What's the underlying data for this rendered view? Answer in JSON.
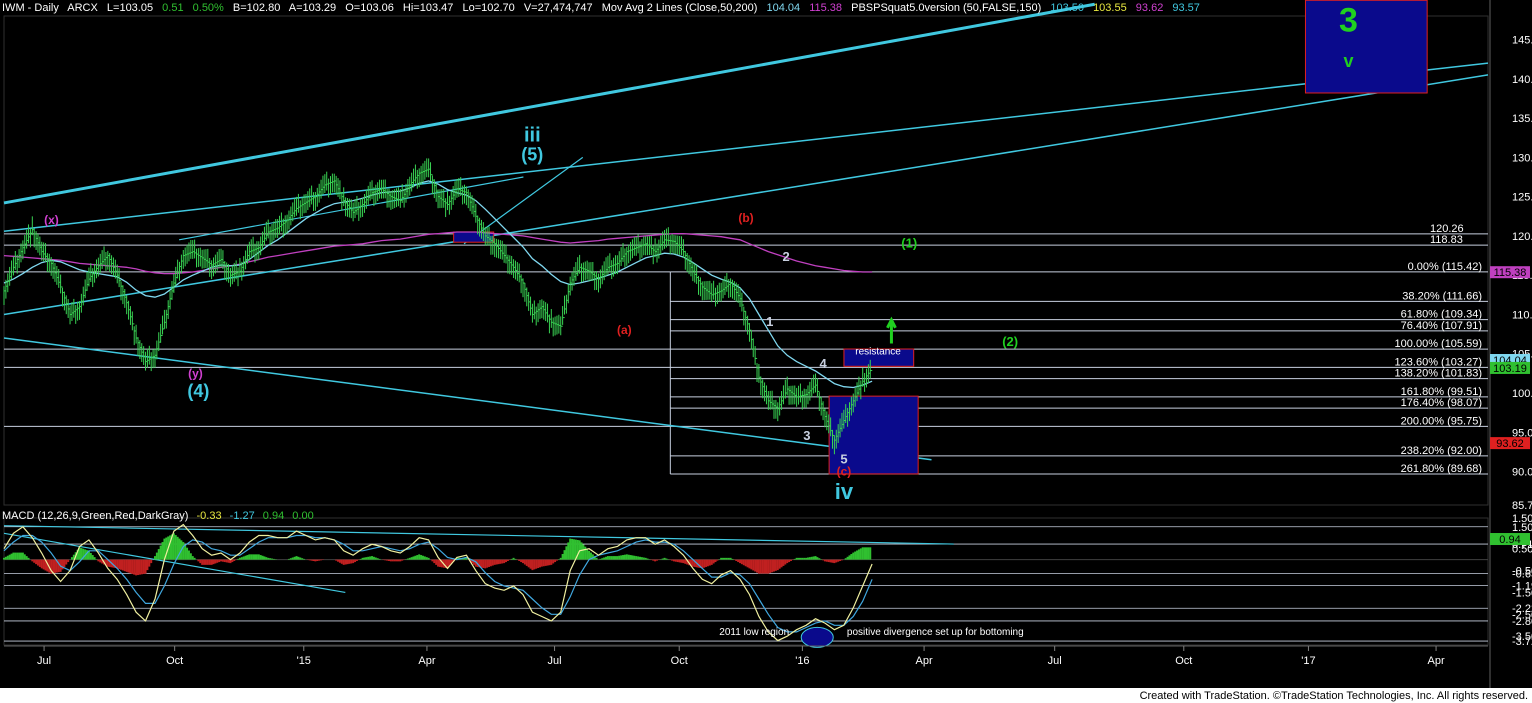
{
  "header": {
    "symbol": "IWM - Daily",
    "exchange": "ARCX",
    "last": "L=103.05",
    "change": "0.51",
    "pct": "0.50%",
    "bid": "B=102.80",
    "ask": "A=103.29",
    "open": "O=103.06",
    "high": "Hi=103.47",
    "low": "Lo=102.70",
    "volume": "V=27,474,747",
    "ma_label": "Mov Avg 2 Lines (Close,50,200)",
    "ma50": "104.04",
    "ma200": "115.38",
    "pbsp_label": "PBSPSquat5.0version (50,FALSE,150)",
    "pbsp_values": [
      "103.50",
      "103.55",
      "93.62",
      "93.57"
    ]
  },
  "macd_header": {
    "label": "MACD (12,26,9,Green,Red,DarkGray)",
    "values": [
      "-0.33",
      "-1.27",
      "0.94",
      "0.00"
    ]
  },
  "colors": {
    "background": "#000000",
    "price_bars": "#39d353",
    "trend_line": "#40c8e0",
    "ma200": "#c040c0",
    "ma50": "#80d8f0",
    "h_line": "#c8d0e0",
    "box_fill": "#0a0a8c",
    "box_border": "#e02020",
    "wave_cyan": "#40c8e0",
    "wave_red": "#e02020",
    "wave_green": "#20d020",
    "wave_magenta": "#d040d0",
    "macd_hist_pos": "#30c030",
    "macd_hist_neg": "#c02020",
    "macd_line": "#f0f0a0",
    "signal_line": "#40a8e0"
  },
  "chart_data": {
    "type": "ohlc",
    "price_axis": {
      "range": [
        85.74,
        148
      ],
      "ticks": [
        "145.00",
        "140.00",
        "135.00",
        "130.00",
        "125.00",
        "120.00",
        "115.00",
        "110.00",
        "105.00",
        "100.00",
        "95.00",
        "90.00",
        "85.74"
      ],
      "tags": [
        {
          "label": "115.38",
          "value": 115.38,
          "color": "#c040c0"
        },
        {
          "label": "104.04",
          "value": 104.2,
          "color": "#80d8f0"
        },
        {
          "label": "103.19",
          "value": 103.19,
          "color": "#30c030"
        },
        {
          "label": "93.62",
          "value": 93.62,
          "color": "#e02020"
        }
      ]
    },
    "time_axis": {
      "labels": [
        "Jul",
        "Oct",
        "'15",
        "Apr",
        "Jul",
        "Oct",
        "'16",
        "Apr",
        "Jul",
        "Oct",
        "'17",
        "Apr"
      ],
      "positions": [
        0.027,
        0.115,
        0.202,
        0.285,
        0.371,
        0.455,
        0.538,
        0.62,
        0.708,
        0.795,
        0.879,
        0.965
      ]
    },
    "close": [
      113.0,
      116.0,
      118.5,
      120.8,
      118.0,
      116.5,
      113.5,
      110.0,
      111.0,
      114.5,
      116.2,
      117.5,
      115.0,
      111.5,
      107.0,
      104.0,
      104.8,
      109.0,
      114.0,
      117.5,
      118.0,
      117.2,
      116.3,
      117.0,
      115.0,
      115.5,
      118.0,
      118.5,
      120.5,
      121.0,
      122.0,
      123.5,
      124.3,
      125.0,
      126.5,
      127.0,
      124.5,
      123.0,
      124.0,
      125.5,
      126.0,
      125.0,
      124.5,
      126.5,
      128.0,
      128.5,
      125.0,
      124.0,
      126.0,
      125.5,
      122.5,
      120.0,
      119.0,
      117.5,
      116.0,
      114.0,
      110.0,
      111.0,
      109.0,
      108.5,
      114.0,
      116.0,
      115.5,
      114.5,
      116.0,
      116.5,
      118.0,
      118.5,
      119.0,
      118.0,
      119.5,
      119.3,
      118.0,
      115.5,
      113.5,
      112.5,
      113.0,
      114.0,
      112.0,
      108.0,
      102.0,
      99.0,
      98.0,
      100.5,
      99.5,
      99.8,
      101.0,
      97.0,
      94.0,
      96.5,
      99.0,
      101.5,
      103.2
    ],
    "ma50": [
      114,
      114.5,
      115.2,
      116,
      116.6,
      116.9,
      116.7,
      116.2,
      115.7,
      115.4,
      115.2,
      115.0,
      114.8,
      114.1,
      113.1,
      112.4,
      112.2,
      112.6,
      113.5,
      114.4,
      115.0,
      115.5,
      116.0,
      116.3,
      116.2,
      116.3,
      117.0,
      117.9,
      118.8,
      119.5,
      120.4,
      121.3,
      122.2,
      122.9,
      123.6,
      124.1,
      124.3,
      124.5,
      124.8,
      125.2,
      125.5,
      125.6,
      125.7,
      126.1,
      126.7,
      127.0,
      126.6,
      125.9,
      125.5,
      125.2,
      124.5,
      123.4,
      122.2,
      121.0,
      119.8,
      118.6,
      117.1,
      116.2,
      115.1,
      114.2,
      113.8,
      114.0,
      114.3,
      114.6,
      115.0,
      115.4,
      116.0,
      116.6,
      117.2,
      117.5,
      117.8,
      117.7,
      117.3,
      116.6,
      115.8,
      115.0,
      114.5,
      114.1,
      113.4,
      112.0,
      110.0,
      108.0,
      106.0,
      104.8,
      104.0,
      103.4,
      102.8,
      102.0,
      101.2,
      100.8,
      100.7,
      101.0,
      101.5
    ],
    "ma200": [
      117.5,
      117.4,
      117.3,
      117.2,
      117.1,
      117.0,
      116.9,
      116.7,
      116.5,
      116.4,
      116.3,
      116.2,
      116.1,
      116.0,
      115.8,
      115.5,
      115.3,
      115.2,
      115.2,
      115.3,
      115.4,
      115.6,
      115.8,
      116.0,
      116.2,
      116.4,
      116.7,
      117.0,
      117.3,
      117.5,
      117.7,
      117.9,
      118.1,
      118.3,
      118.5,
      118.7,
      118.8,
      118.9,
      119.0,
      119.2,
      119.4,
      119.5,
      119.6,
      119.8,
      120.0,
      120.2,
      120.3,
      120.4,
      120.5,
      120.5,
      120.5,
      120.4,
      120.3,
      120.2,
      120.1,
      120.0,
      119.8,
      119.6,
      119.4,
      119.2,
      119.1,
      119.2,
      119.3,
      119.4,
      119.6,
      119.7,
      119.8,
      119.9,
      120.0,
      120.1,
      120.2,
      120.3,
      120.3,
      120.2,
      120.1,
      120.0,
      119.9,
      119.7,
      119.5,
      119.0,
      118.5,
      118.0,
      117.6,
      117.2,
      116.8,
      116.5,
      116.2,
      116.0,
      115.8,
      115.6,
      115.5,
      115.4,
      115.4
    ],
    "fib_levels": [
      {
        "label": "0.00% (115.42)",
        "value": 115.42
      },
      {
        "label": "38.20% (111.66)",
        "value": 111.66
      },
      {
        "label": "61.80% (109.34)",
        "value": 109.34
      },
      {
        "label": "76.40% (107.91)",
        "value": 107.91
      },
      {
        "label": "100.00% (105.59)",
        "value": 105.59
      },
      {
        "label": "123.60% (103.27)",
        "value": 103.27
      },
      {
        "label": "138.20% (101.83)",
        "value": 101.83
      },
      {
        "label": "161.80% (99.51)",
        "value": 99.51
      },
      {
        "label": "176.40% (98.07)",
        "value": 98.07
      },
      {
        "label": "200.00% (95.75)",
        "value": 95.75
      },
      {
        "label": "238.20% (92.00)",
        "value": 92.0
      },
      {
        "label": "261.80% (89.68)",
        "value": 89.68
      }
    ],
    "horizontal_levels": [
      {
        "label": "120.26",
        "value": 120.26
      },
      {
        "label": "118.83",
        "value": 118.83
      }
    ],
    "wave_labels": [
      {
        "text": "3",
        "value": 146.0,
        "pos": 0.906,
        "color": "#20d020",
        "size": 34
      },
      {
        "text": "v",
        "value": 141.5,
        "pos": 0.906,
        "color": "#20d020",
        "size": 18
      },
      {
        "text": "iii",
        "value": 132.0,
        "pos": 0.356,
        "color": "#40c8e0",
        "size": 20
      },
      {
        "text": "(5)",
        "value": 129.6,
        "pos": 0.356,
        "color": "#40c8e0",
        "size": 18
      },
      {
        "text": "(x)",
        "value": 121.5,
        "pos": 0.032,
        "color": "#d040d0",
        "size": 12
      },
      {
        "text": "(y)",
        "value": 102.0,
        "pos": 0.129,
        "color": "#d040d0",
        "size": 12
      },
      {
        "text": "(4)",
        "value": 99.5,
        "pos": 0.131,
        "color": "#40c8e0",
        "size": 18
      },
      {
        "text": "(b)",
        "value": 121.8,
        "pos": 0.5,
        "color": "#e02020",
        "size": 12
      },
      {
        "text": "(a)",
        "value": 107.5,
        "pos": 0.418,
        "color": "#e02020",
        "size": 12
      },
      {
        "text": "2",
        "value": 116.8,
        "pos": 0.527,
        "color": "#c8d0e0",
        "size": 13
      },
      {
        "text": "1",
        "value": 108.5,
        "pos": 0.516,
        "color": "#c8d0e0",
        "size": 13
      },
      {
        "text": "4",
        "value": 103.2,
        "pos": 0.552,
        "color": "#c8d0e0",
        "size": 13
      },
      {
        "text": "3",
        "value": 94.0,
        "pos": 0.541,
        "color": "#c8d0e0",
        "size": 13
      },
      {
        "text": "5",
        "value": 91.0,
        "pos": 0.566,
        "color": "#c8d0e0",
        "size": 13
      },
      {
        "text": "(c)",
        "value": 89.5,
        "pos": 0.566,
        "color": "#e02020",
        "size": 12
      },
      {
        "text": "iv",
        "value": 86.5,
        "pos": 0.566,
        "color": "#40c8e0",
        "size": 22
      },
      {
        "text": "(1)",
        "value": 118.5,
        "pos": 0.61,
        "color": "#20d020",
        "size": 13
      },
      {
        "text": "(2)",
        "value": 106.0,
        "pos": 0.678,
        "color": "#20d020",
        "size": 13
      }
    ],
    "resistance_label": "resistance",
    "macd": {
      "range": [
        -3.9,
        1.9
      ],
      "ticks": [
        "1.50",
        "0.71",
        "-0.63",
        "-1.19",
        "-2.22",
        "-2.80",
        "-3.72",
        "1.50",
        "0.50",
        "-0.50",
        "-1.50",
        "-2.50",
        "-3.50"
      ],
      "tick_values": [
        1.9,
        0.71,
        -0.63,
        -1.19,
        -2.22,
        -2.8,
        -3.72,
        1.5,
        0.5,
        -0.5,
        -1.5,
        -2.5,
        -3.5
      ],
      "tag": {
        "label": "0.94",
        "value": 0.94
      },
      "macd_line": [
        0.5,
        1.2,
        1.5,
        1.0,
        0.3,
        -0.5,
        -1.0,
        -0.5,
        0.6,
        0.9,
        0.3,
        -0.4,
        -0.9,
        -1.6,
        -2.4,
        -2.8,
        -1.8,
        0.0,
        1.3,
        1.6,
        1.1,
        0.5,
        0.2,
        0.3,
        0.0,
        0.3,
        0.8,
        1.1,
        1.1,
        1.0,
        1.0,
        1.3,
        1.1,
        0.9,
        1.0,
        0.9,
        0.4,
        0.2,
        0.5,
        0.7,
        0.6,
        0.4,
        0.3,
        0.6,
        1.0,
        0.9,
        0.1,
        -0.4,
        0.1,
        0.2,
        -0.5,
        -1.1,
        -1.3,
        -1.4,
        -1.2,
        -1.6,
        -2.4,
        -2.6,
        -2.8,
        -2.4,
        -0.5,
        0.4,
        0.5,
        0.2,
        0.5,
        0.6,
        0.9,
        1.0,
        1.0,
        0.7,
        0.9,
        0.6,
        0.2,
        -0.4,
        -0.9,
        -1.1,
        -0.7,
        -0.5,
        -0.9,
        -1.6,
        -2.6,
        -3.3,
        -3.7,
        -3.5,
        -3.2,
        -3.0,
        -2.7,
        -2.9,
        -3.2,
        -3.0,
        -2.2,
        -1.2,
        -0.2
      ],
      "signal_line": [
        0.4,
        0.8,
        1.1,
        1.1,
        0.8,
        0.3,
        -0.3,
        -0.5,
        -0.1,
        0.4,
        0.4,
        0.0,
        -0.4,
        -0.9,
        -1.5,
        -2.0,
        -2.0,
        -1.2,
        -0.2,
        0.6,
        0.9,
        0.8,
        0.5,
        0.4,
        0.2,
        0.2,
        0.5,
        0.8,
        1.0,
        1.0,
        1.0,
        1.1,
        1.1,
        1.0,
        1.0,
        0.9,
        0.7,
        0.4,
        0.4,
        0.5,
        0.6,
        0.5,
        0.4,
        0.5,
        0.7,
        0.8,
        0.5,
        0.1,
        0.0,
        0.1,
        -0.1,
        -0.6,
        -1.0,
        -1.2,
        -1.3,
        -1.4,
        -1.8,
        -2.2,
        -2.5,
        -2.5,
        -1.7,
        -0.7,
        0.0,
        0.2,
        0.3,
        0.4,
        0.6,
        0.8,
        0.9,
        0.8,
        0.8,
        0.7,
        0.4,
        0.0,
        -0.4,
        -0.8,
        -0.8,
        -0.6,
        -0.7,
        -1.1,
        -1.8,
        -2.5,
        -3.1,
        -3.3,
        -3.3,
        -3.1,
        -2.9,
        -2.8,
        -3.0,
        -3.0,
        -2.6,
        -1.9,
        -0.9
      ],
      "annotations": [
        "2011 low region",
        "positive divergence set up for bottoming"
      ]
    }
  },
  "footer": "Created with TradeStation. ©TradeStation Technologies, Inc. All rights reserved."
}
